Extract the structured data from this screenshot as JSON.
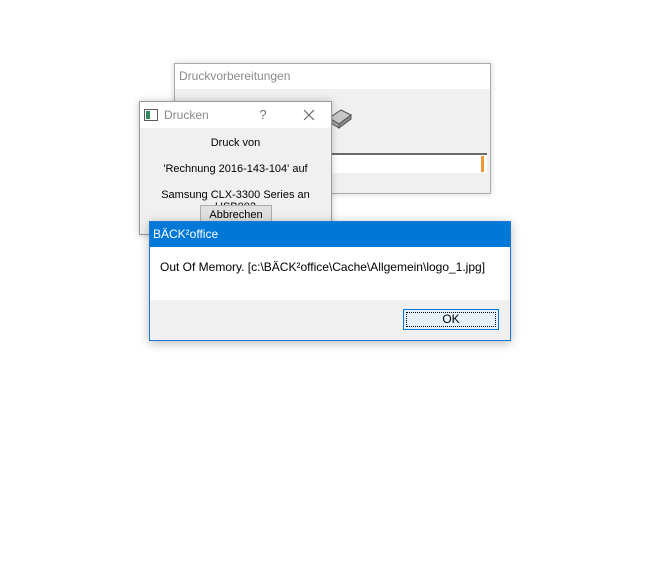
{
  "prep_window": {
    "title": "Druckvorbereitungen"
  },
  "print_dialog": {
    "title": "Drucken",
    "help_label": "?",
    "line1": "Druck von",
    "line2": "'Rechnung 2016-143-104' auf",
    "line3": "Samsung CLX-3300 Series an USB002",
    "cancel_label": "Abbrechen"
  },
  "message_box": {
    "title": "BÄCK²office",
    "message": "Out Of Memory. [c:\\BÄCK²office\\Cache\\Allgemein\\logo_1.jpg]",
    "ok_label": "OK"
  },
  "colors": {
    "accent": "#0078d7",
    "progress": "#ea9a35"
  }
}
